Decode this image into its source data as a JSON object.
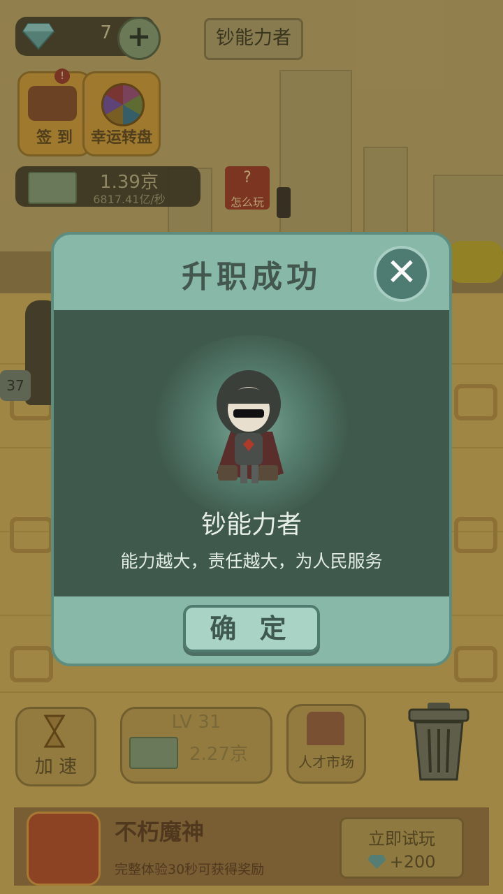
{
  "hud": {
    "gem_count": "7",
    "title": "钞能力者",
    "checkin_label": "签 到",
    "checkin_badge": "!",
    "wheel_label": "幸运转盘",
    "money_total": "1.39京",
    "money_rate": "6817.41亿/秒",
    "help_label": "怎么玩",
    "slot_level_badge": "37"
  },
  "dialog": {
    "title": "升职成功",
    "character_name": "钞能力者",
    "description": "能力越大，责任越大，为人民服务",
    "confirm_label": "确 定",
    "close_symbol": "✕"
  },
  "bottom_bar": {
    "speed_label": "加 速",
    "buy_level": "LV 31",
    "buy_price": "2.27京",
    "market_label": "人才市场"
  },
  "ad": {
    "title": "不朽魔神",
    "subtitle": "完整体验30秒可获得奖励",
    "try_label": "立即试玩",
    "reward": "+200"
  },
  "colors": {
    "dialog_header": "#88b8a8",
    "dialog_body": "#3f5a4c",
    "confirm_button": "#a9d3c5"
  }
}
